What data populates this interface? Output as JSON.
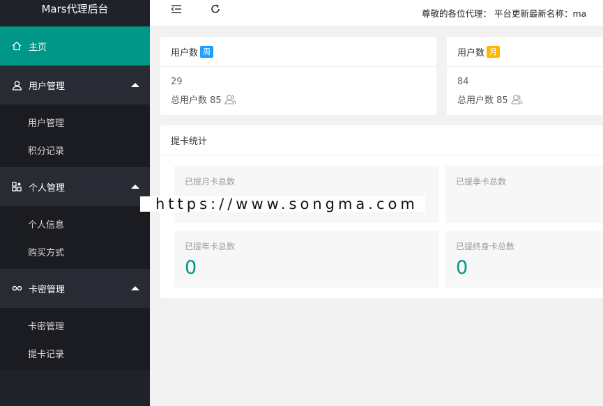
{
  "brand": "Mars代理后台",
  "sidebar": {
    "home": {
      "label": "主页",
      "icon": "home-icon"
    },
    "groups": [
      {
        "label": "用户管理",
        "icon": "user-icon",
        "items": [
          "用户管理",
          "积分记录"
        ]
      },
      {
        "label": "个人管理",
        "icon": "apps-icon",
        "items": [
          "个人信息",
          "购买方式"
        ]
      },
      {
        "label": "卡密管理",
        "icon": "link-icon",
        "items": [
          "卡密管理",
          "提卡记录"
        ]
      }
    ]
  },
  "header": {
    "menu_icon": "menu-toggle-icon",
    "refresh_icon": "refresh-icon",
    "notice": "尊敬的各位代理： 平台更新最新名称：ma"
  },
  "cards": [
    {
      "title": "用户数",
      "badge": "周",
      "badge_color": "#1e9fff",
      "value": "29",
      "total_text": "总用户数 85"
    },
    {
      "title": "用户数",
      "badge": "月",
      "badge_color": "#ffb800",
      "value": "84",
      "total_text": "总用户数 85"
    }
  ],
  "stats": {
    "title": "提卡统计",
    "tiles": [
      {
        "label": "已提月卡总数",
        "value": ""
      },
      {
        "label": "已提季卡总数",
        "value": ""
      },
      {
        "label": "已提年卡总数",
        "value": "0"
      },
      {
        "label": "已提终身卡总数",
        "value": "0"
      }
    ]
  },
  "watermark": "https://www.songma.com",
  "colors": {
    "accent": "#009688",
    "sidebar_bg": "#20222a"
  }
}
